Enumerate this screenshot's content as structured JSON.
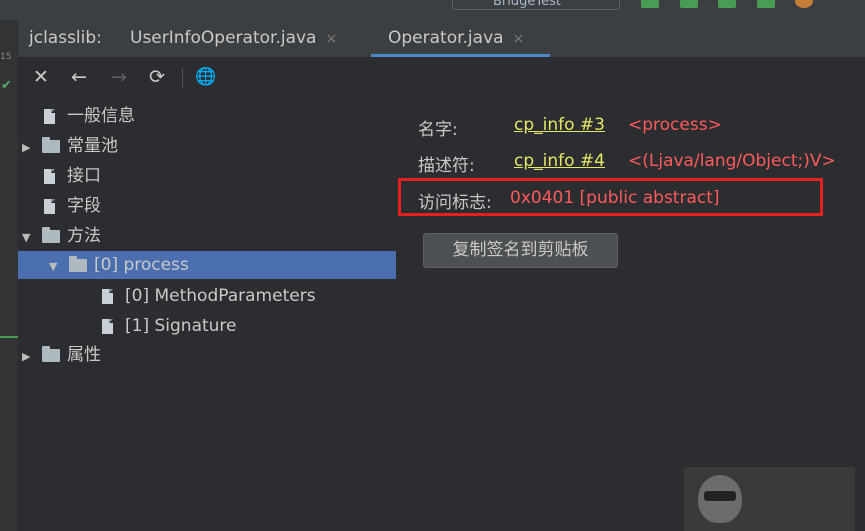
{
  "top": {
    "run_config": "BridgeTest"
  },
  "gutter": {
    "line_number": "15"
  },
  "tabs": {
    "prefix": "jclasslib:",
    "items": [
      {
        "label": "UserInfoOperator.java",
        "active": false
      },
      {
        "label": "Operator.java",
        "active": true
      }
    ],
    "close_glyph": "×"
  },
  "toolbar": {
    "close": "✕",
    "back": "←",
    "forward": "→",
    "refresh": "⟳",
    "web": "🌐"
  },
  "tree": {
    "general": "一般信息",
    "constant_pool": "常量池",
    "interfaces": "接口",
    "fields": "字段",
    "methods": "方法",
    "method0": "[0] process",
    "method0_params": "[0] MethodParameters",
    "method0_signature": "[1] Signature",
    "attributes": "属性"
  },
  "info": {
    "name_label": "名字:",
    "name_link": "cp_info #3",
    "name_value": "<process>",
    "descriptor_label": "描述符:",
    "descriptor_link": "cp_info #4",
    "descriptor_value": "<(Ljava/lang/Object;)V>",
    "access_label": "访问标志:",
    "access_value": "0x0401 [public abstract]",
    "copy_button": "复制签名到剪贴板"
  },
  "colors": {
    "accent": "#4b6eaf",
    "link": "#e6e665",
    "value_red": "#ff5a5a",
    "highlight_box": "#e52020"
  }
}
